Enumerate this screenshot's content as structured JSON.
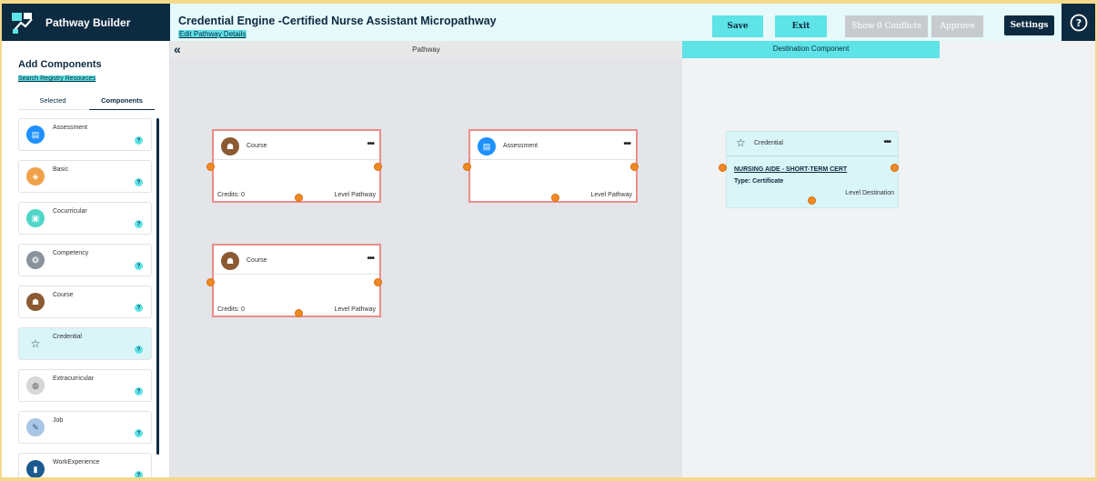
{
  "app": {
    "brand_name": "Pathway Builder",
    "title": "Credential Engine -Certified Nurse Assistant Micropathway",
    "edit_link": "Edit Pathway Details"
  },
  "toolbar": {
    "save": "Save",
    "exit": "Exit",
    "show_conflicts": "Show 0 Conflicts",
    "approve": "Approve",
    "settings": "Settings",
    "help_glyph": "?"
  },
  "sidebar": {
    "title": "Add Components",
    "search_link": "Search Registry Resources",
    "tabs": [
      {
        "label": "Selected",
        "active": false
      },
      {
        "label": "Components",
        "active": true
      }
    ],
    "items": [
      {
        "label": "Assessment",
        "icon": "assessment-icon",
        "color": "#1e90ff"
      },
      {
        "label": "Basic",
        "icon": "basic-icon",
        "color": "#f0a14a"
      },
      {
        "label": "Cocurricular",
        "icon": "cocurricular-icon",
        "color": "#4fd6c8"
      },
      {
        "label": "Competency",
        "icon": "competency-icon",
        "color": "#8a939c"
      },
      {
        "label": "Course",
        "icon": "course-icon",
        "color": "#8b5a32"
      },
      {
        "label": "Credential",
        "icon": "star-icon",
        "color": "#d9f5f7"
      },
      {
        "label": "Extracurricular",
        "icon": "extracurricular-icon",
        "color": "#d7d7d7"
      },
      {
        "label": "Job",
        "icon": "job-icon",
        "color": "#a9c6e6"
      },
      {
        "label": "WorkExperience",
        "icon": "work-experience-icon",
        "color": "#1a5a8f"
      }
    ]
  },
  "canvas": {
    "collapse_glyph": "«",
    "pathway_label": "Pathway",
    "destination_label": "Destination Component",
    "nodes": [
      {
        "label": "Course",
        "credits": "Credits: 0",
        "level": "Level Pathway"
      },
      {
        "label": "Assessment",
        "credits": "",
        "level": "Level Pathway"
      },
      {
        "label": "Course",
        "credits": "Credits: 0",
        "level": "Level Pathway"
      }
    ],
    "destination_node": {
      "label": "Credential",
      "name": "NURSING AIDE - SHORT-TERM CERT",
      "type": "Type: Certificate",
      "level": "Level Destination"
    }
  },
  "colors": {
    "navy": "#0c2a40",
    "accent": "#5ee3e6",
    "port": "#ef8a22",
    "node_border": "#ec8d8a"
  }
}
